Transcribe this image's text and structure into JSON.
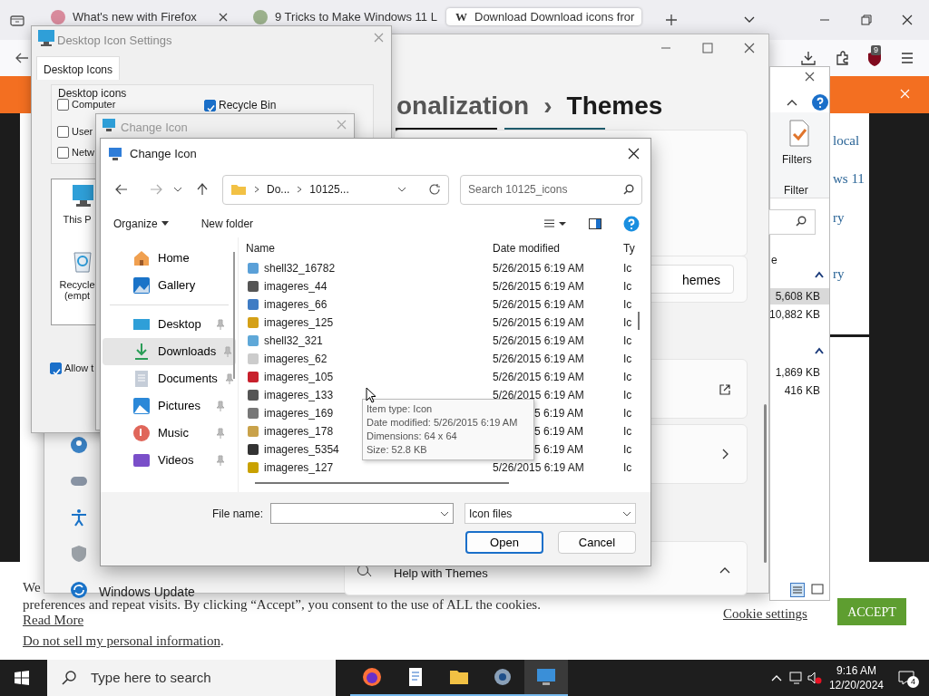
{
  "browser": {
    "tabs": [
      {
        "title": "What's new with Firefox",
        "selected": false
      },
      {
        "title": "9 Tricks to Make Windows 11 L",
        "selected": false
      },
      {
        "title": "Download Download icons fror",
        "icon_text": "W",
        "selected": true
      }
    ],
    "extension_badge": "9",
    "page_links": [
      "local",
      "ws 11",
      "ry",
      "ry"
    ],
    "cookie_bar": {
      "lead": "We",
      "text": "preferences and repeat visits. By clicking “Accept”, you consent to the use of ALL the cookies.",
      "read_more": "Read More",
      "do_not_sell": "Do not sell my personal information",
      "period": ".",
      "settings": "Cookie settings",
      "accept": "ACCEPT"
    }
  },
  "settings_window": {
    "breadcrumb_parent": "onalization",
    "breadcrumb_separator": "›",
    "breadcrumb_current": "Themes",
    "button": "hemes",
    "help": "Help with Themes",
    "nav_item": "Windows Update"
  },
  "explorer_window": {
    "ribbon_button": "Filters",
    "ribbon_group": "Filter",
    "column_fragment": "e",
    "sizes": [
      {
        "text": "5,608 KB",
        "selected": true
      },
      {
        "text": "10,882 KB",
        "selected": false
      },
      {
        "text": "1,869 KB",
        "selected": false
      },
      {
        "text": "416 KB",
        "selected": false
      }
    ]
  },
  "desktop_icon_settings": {
    "title": "Desktop Icon Settings",
    "tab": "Desktop Icons",
    "group": "Desktop icons",
    "checkboxes": [
      {
        "label": "Computer",
        "checked": false
      },
      {
        "label": "User",
        "checked": false
      },
      {
        "label": "Netw",
        "checked": false
      },
      {
        "label": "Recycle Bin",
        "checked": true
      }
    ],
    "icons": [
      {
        "kind": "monitor",
        "label": "This P"
      },
      {
        "kind": "recycle",
        "label": "Recycle (empt"
      }
    ],
    "allow": {
      "label": "Allow t",
      "checked": true
    }
  },
  "change_icon_back": {
    "title": "Change Icon"
  },
  "open_dialog": {
    "title": "Change Icon",
    "path": [
      "Do...",
      "10125..."
    ],
    "search_placeholder": "Search 10125_icons",
    "toolbar": [
      "Organize",
      "New folder"
    ],
    "nav": [
      {
        "label": "Home",
        "kind": "home",
        "pinned": false,
        "selected": false
      },
      {
        "label": "Gallery",
        "kind": "gallery",
        "pinned": false,
        "selected": false
      },
      {
        "label": "Desktop",
        "kind": "desktop",
        "pinned": true,
        "selected": false
      },
      {
        "label": "Downloads",
        "kind": "download",
        "pinned": true,
        "selected": true
      },
      {
        "label": "Documents",
        "kind": "document",
        "pinned": true,
        "selected": false
      },
      {
        "label": "Pictures",
        "kind": "picture",
        "pinned": true,
        "selected": false
      },
      {
        "label": "Music",
        "kind": "music",
        "pinned": true,
        "selected": false
      },
      {
        "label": "Videos",
        "kind": "video",
        "pinned": true,
        "selected": false
      }
    ],
    "columns": [
      "Name",
      "Date modified",
      "Ty"
    ],
    "rows": [
      {
        "name": "shell32_16782",
        "date": "5/26/2015 6:19 AM",
        "type": "Ic"
      },
      {
        "name": "imageres_44",
        "date": "5/26/2015 6:19 AM",
        "type": "Ic"
      },
      {
        "name": "imageres_66",
        "date": "5/26/2015 6:19 AM",
        "type": "Ic"
      },
      {
        "name": "imageres_125",
        "date": "5/26/2015 6:19 AM",
        "type": "Ic"
      },
      {
        "name": "shell32_321",
        "date": "5/26/2015 6:19 AM",
        "type": "Ic"
      },
      {
        "name": "imageres_62",
        "date": "5/26/2015 6:19 AM",
        "type": "Ic"
      },
      {
        "name": "imageres_105",
        "date": "5/26/2015 6:19 AM",
        "type": "Ic"
      },
      {
        "name": "imageres_133",
        "date": "5/26/2015 6:19 AM",
        "type": "Ic"
      },
      {
        "name": "imageres_169",
        "date": "5 6:19 AM",
        "type": "Ic"
      },
      {
        "name": "imageres_178",
        "date": "5 6:19 AM",
        "type": "Ic"
      },
      {
        "name": "imageres_5354",
        "date": "5 6:19 AM",
        "type": "Ic"
      },
      {
        "name": "imageres_127",
        "date": "5/26/2015 6:19 AM",
        "type": "Ic"
      }
    ],
    "tooltip": [
      "Item type: Icon",
      "Date modified: 5/26/2015 6:19 AM",
      "Dimensions: 64 x 64",
      "Size: 52.8 KB"
    ],
    "file_name_label": "File name:",
    "file_type": "Icon files",
    "buttons": [
      "Open",
      "Cancel"
    ]
  },
  "taskbar": {
    "search_placeholder": "Type here to search",
    "apps": [
      {
        "kind": "firefox",
        "selected": false
      },
      {
        "kind": "notepad",
        "selected": false
      },
      {
        "kind": "folder",
        "selected": false
      },
      {
        "kind": "gear",
        "selected": false
      },
      {
        "kind": "monitor",
        "selected": true
      }
    ],
    "time": "9:16 AM",
    "date": "12/20/2024",
    "notifications": "4"
  }
}
